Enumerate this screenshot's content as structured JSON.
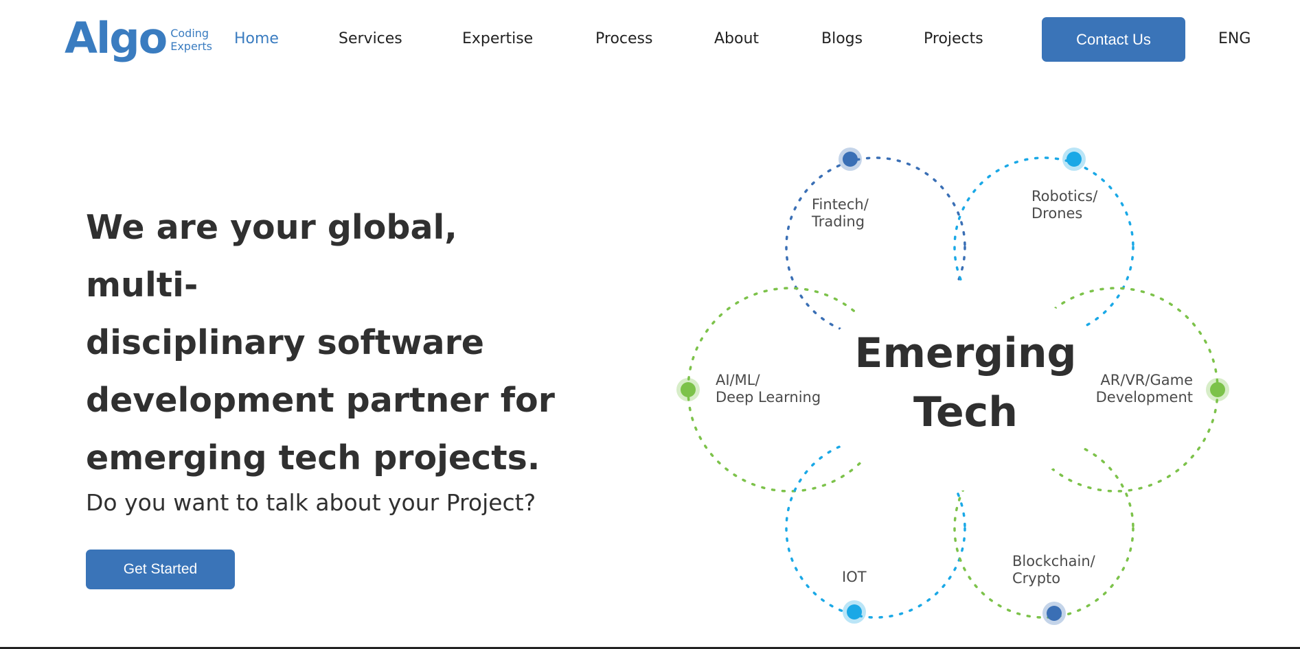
{
  "brand": {
    "logo_main": "Algo",
    "logo_tag_line1": "Coding",
    "logo_tag_line2": "Experts",
    "accent_color": "#3a7cc0"
  },
  "nav": {
    "items": [
      {
        "label": "Home",
        "active": true
      },
      {
        "label": "Services",
        "active": false
      },
      {
        "label": "Expertise",
        "active": false
      },
      {
        "label": "Process",
        "active": false
      },
      {
        "label": "About",
        "active": false
      },
      {
        "label": "Blogs",
        "active": false
      },
      {
        "label": "Projects",
        "active": false
      }
    ],
    "contact_label": "Contact Us",
    "language": "ENG"
  },
  "hero": {
    "headline_lines": [
      "We are your global, multi-",
      "disciplinary software",
      "development partner for",
      "emerging tech projects."
    ],
    "subline": "Do you want to talk about your Project?",
    "cta_label": "Get Started"
  },
  "diagram": {
    "center_line1": "Emerging",
    "center_line2": "Tech",
    "nodes": [
      {
        "line1": "Fintech/",
        "line2": "Trading",
        "color": "#3a6fb5"
      },
      {
        "line1": "Robotics/",
        "line2": "Drones",
        "color": "#1aa8e6"
      },
      {
        "line1": "AI/ML/",
        "line2": "Deep Learning",
        "color": "#7cc24a"
      },
      {
        "line1": "AR/VR/Game",
        "line2": "Development",
        "color": "#7cc24a"
      },
      {
        "line1": "IOT",
        "line2": "",
        "color": "#1aa8e6"
      },
      {
        "line1": "Blockchain/",
        "line2": "Crypto",
        "color": "#3a6fb5"
      }
    ]
  }
}
